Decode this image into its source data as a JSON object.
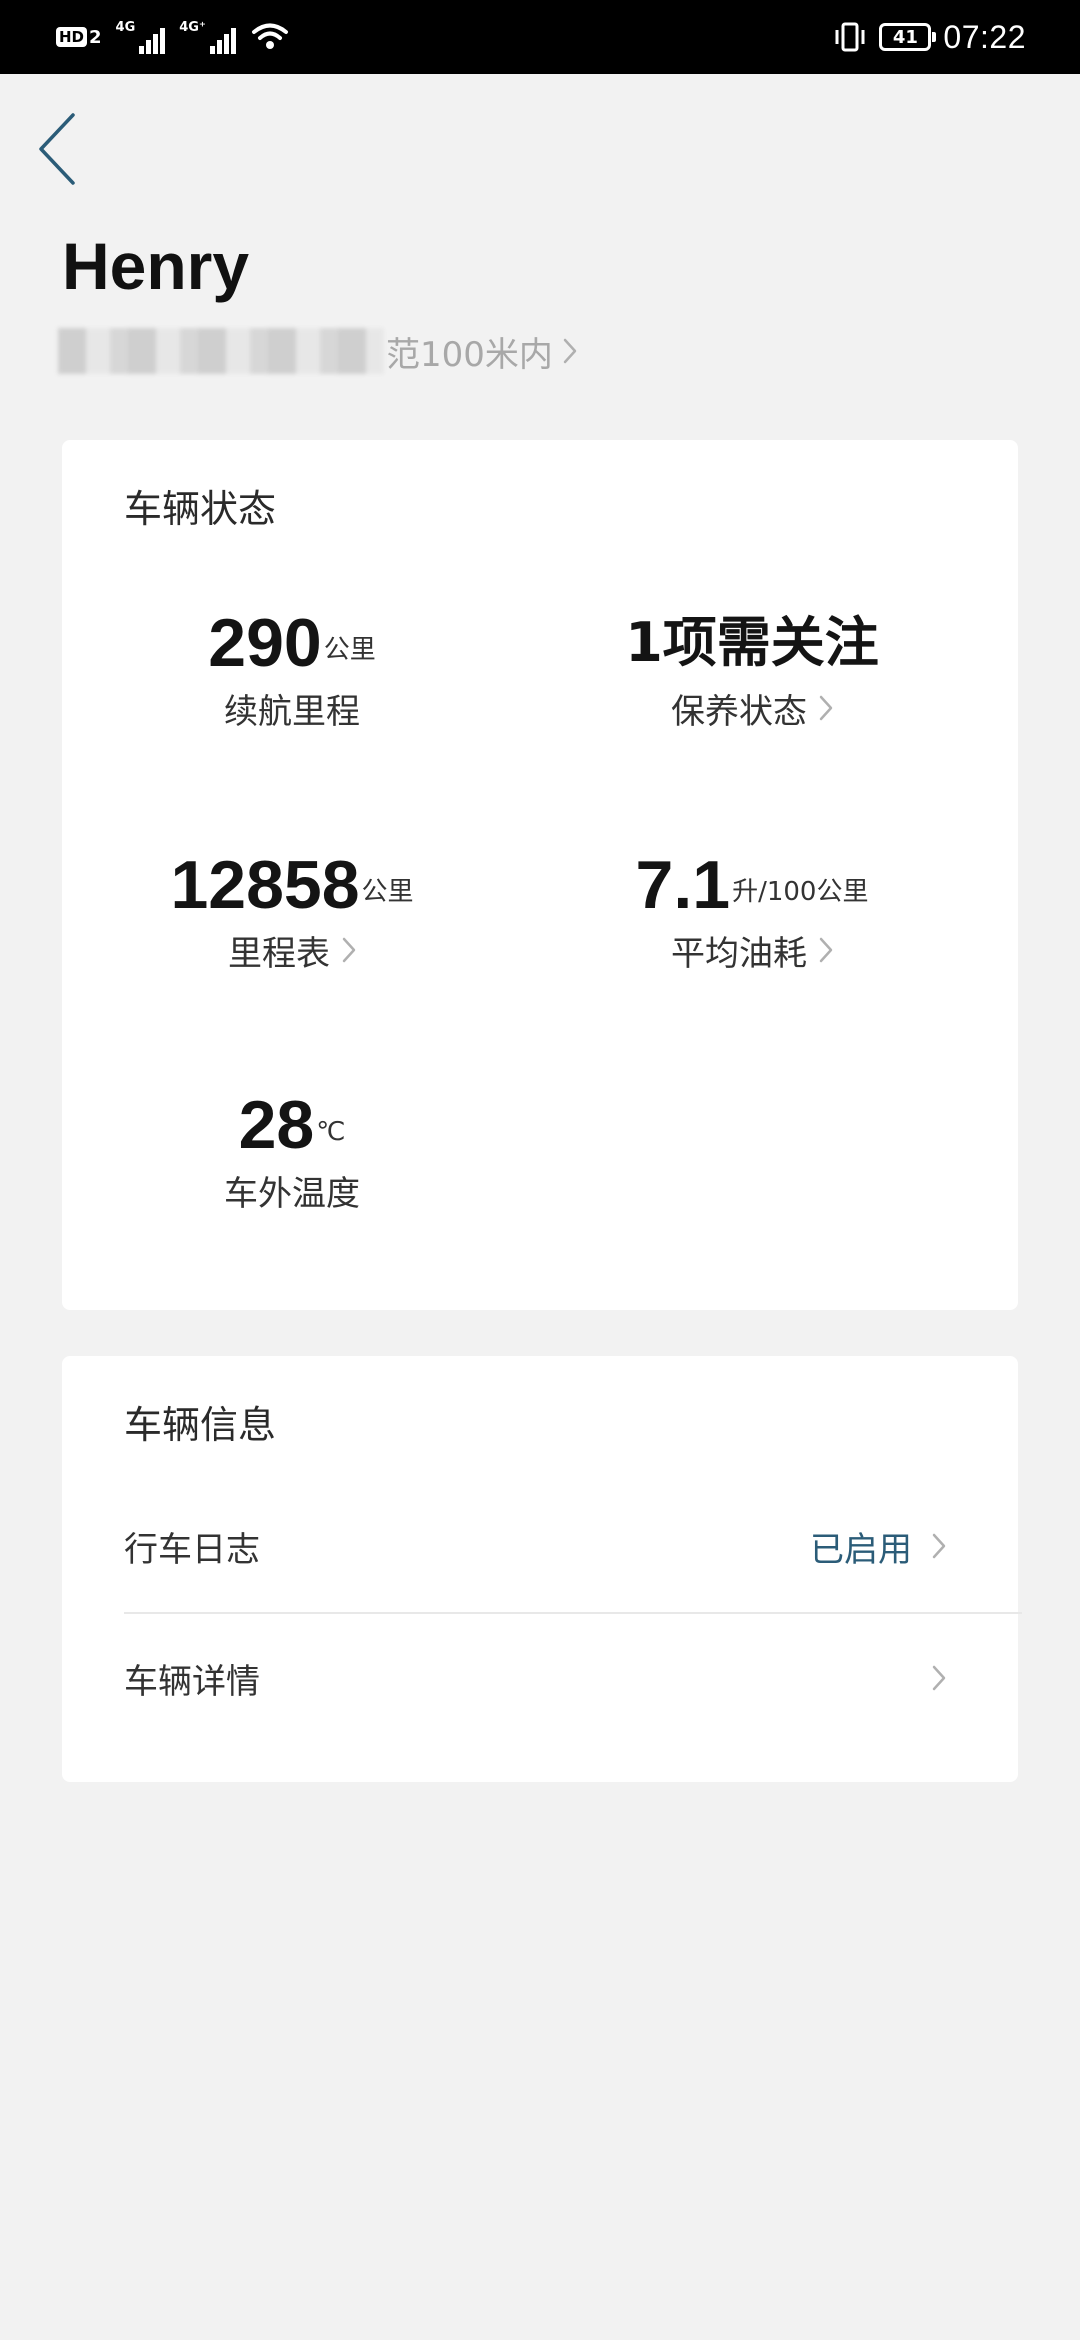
{
  "status_bar": {
    "hd_label": "HD",
    "sim_label": "2",
    "net1_label": "4G",
    "net2_label": "4G⁺",
    "battery_level": "41",
    "time": "07:22"
  },
  "header": {
    "title": "Henry",
    "location_visible_text": "范100米内"
  },
  "vehicle_status": {
    "title": "车辆状态",
    "stats": [
      {
        "value": "290",
        "unit": "公里",
        "label": "续航里程",
        "has_chevron": false
      },
      {
        "value": "1项需关注",
        "unit": "",
        "label": "保养状态",
        "has_chevron": true
      },
      {
        "value": "12858",
        "unit": "公里",
        "label": "里程表",
        "has_chevron": true
      },
      {
        "value": "7.1",
        "unit": "升/100公里",
        "label": "平均油耗",
        "has_chevron": true
      },
      {
        "value": "28",
        "unit": "℃",
        "label": "车外温度",
        "has_chevron": false
      }
    ]
  },
  "vehicle_info": {
    "title": "车辆信息",
    "rows": [
      {
        "label": "行车日志",
        "status": "已启用"
      },
      {
        "label": "车辆详情",
        "status": ""
      }
    ]
  },
  "colors": {
    "accent": "#2b5c78",
    "background": "#f2f2f2",
    "card": "#ffffff"
  }
}
